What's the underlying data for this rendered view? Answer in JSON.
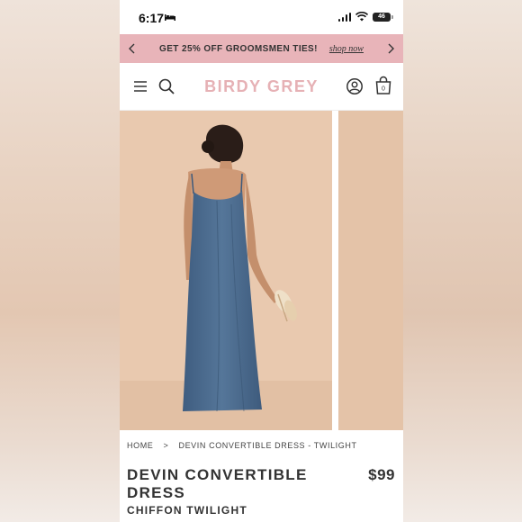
{
  "status_bar": {
    "time": "6:17",
    "battery": "46"
  },
  "promo": {
    "text": "GET 25% OFF GROOMSMEN TIES!",
    "link": "shop now"
  },
  "header": {
    "logo": "BIRDY GREY",
    "cart_count": "0"
  },
  "breadcrumb": {
    "home": "HOME",
    "separator": ">",
    "current": "DEVIN CONVERTIBLE DRESS - TWILIGHT"
  },
  "product": {
    "title": "DEVIN CONVERTIBLE DRESS",
    "price": "$99",
    "subtitle": "CHIFFON TWILIGHT"
  },
  "colors": {
    "promo_bg": "#e8b4b9",
    "logo": "#e6b1b5",
    "dress": "#4f6f93",
    "photo_bg": "#e8c8ae"
  },
  "icons": [
    "bed-icon",
    "signal-icon",
    "wifi-icon",
    "battery-icon",
    "chevron-left-icon",
    "chevron-right-icon",
    "menu-icon",
    "search-icon",
    "account-icon",
    "bag-icon"
  ]
}
